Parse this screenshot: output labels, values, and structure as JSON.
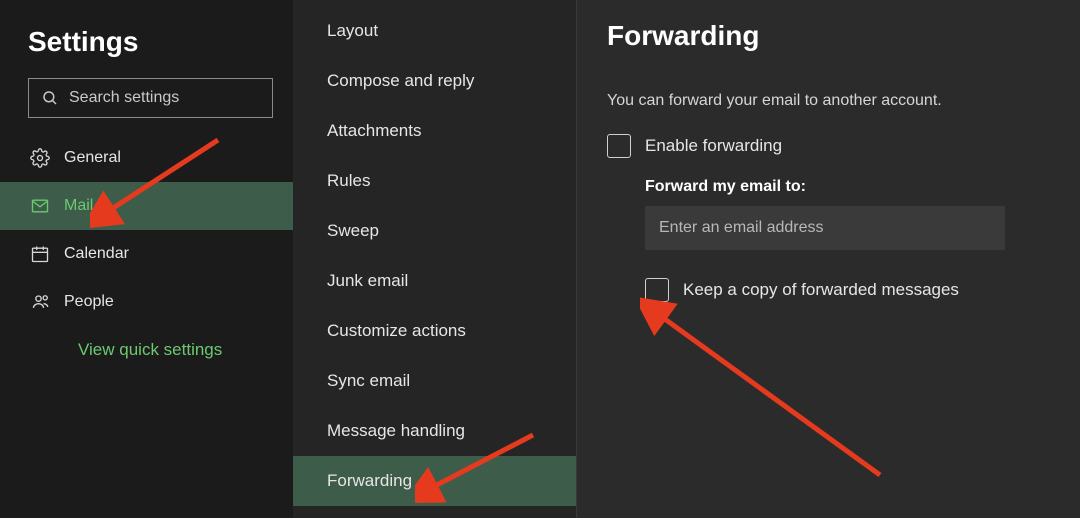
{
  "settings": {
    "title": "Settings",
    "search_placeholder": "Search settings",
    "nav": [
      {
        "id": "general",
        "label": "General",
        "icon": "gear",
        "selected": false
      },
      {
        "id": "mail",
        "label": "Mail",
        "icon": "mail",
        "selected": true
      },
      {
        "id": "calendar",
        "label": "Calendar",
        "icon": "calendar",
        "selected": false
      },
      {
        "id": "people",
        "label": "People",
        "icon": "people",
        "selected": false
      }
    ],
    "quick_link": "View quick settings"
  },
  "mail_settings": {
    "items": [
      {
        "id": "layout",
        "label": "Layout",
        "selected": false
      },
      {
        "id": "compose",
        "label": "Compose and reply",
        "selected": false
      },
      {
        "id": "attachments",
        "label": "Attachments",
        "selected": false
      },
      {
        "id": "rules",
        "label": "Rules",
        "selected": false
      },
      {
        "id": "sweep",
        "label": "Sweep",
        "selected": false
      },
      {
        "id": "junk",
        "label": "Junk email",
        "selected": false
      },
      {
        "id": "customize",
        "label": "Customize actions",
        "selected": false
      },
      {
        "id": "sync",
        "label": "Sync email",
        "selected": false
      },
      {
        "id": "message_handling",
        "label": "Message handling",
        "selected": false
      },
      {
        "id": "forwarding",
        "label": "Forwarding",
        "selected": true
      }
    ]
  },
  "forwarding": {
    "title": "Forwarding",
    "description": "You can forward your email to another account.",
    "enable_label": "Enable forwarding",
    "enable_checked": false,
    "forward_to_label": "Forward my email to:",
    "forward_to_value": "",
    "forward_to_placeholder": "Enter an email address",
    "keep_copy_label": "Keep a copy of forwarded messages",
    "keep_copy_checked": false
  },
  "annotations": {
    "arrow_color": "#e63a1f"
  }
}
